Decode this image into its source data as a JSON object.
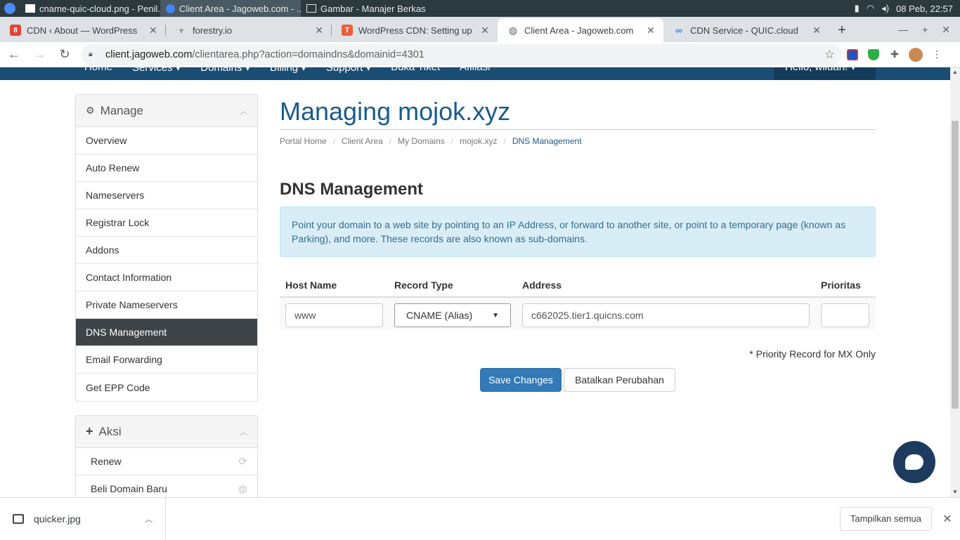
{
  "os": {
    "windows": [
      {
        "label": "cname-quic-cloud.png - Penil..."
      },
      {
        "label": "Client Area - Jagoweb.com - ..."
      },
      {
        "label": "Gambar - Manajer Berkas"
      }
    ],
    "clock": "08 Peb, 22:57"
  },
  "browser": {
    "tabs": [
      {
        "label": "CDN ‹ About — WordPress",
        "favicon_color": "#e0443a"
      },
      {
        "label": "forestry.io",
        "favicon_color": "#3c4043"
      },
      {
        "label": "WordPress CDN: Setting up qu",
        "favicon_color": "#e8613c"
      },
      {
        "label": "Client Area - Jagoweb.com",
        "favicon_color": "#5f6368"
      },
      {
        "label": "CDN Service - QUIC.cloud",
        "favicon_color": "#3a8ed8"
      }
    ],
    "active_tab": 3,
    "url_host": "client.jagoweb.com",
    "url_path": "/clientarea.php?action=domaindns&domainid=4301"
  },
  "site": {
    "nav": [
      "Home",
      "Services ▾",
      "Domains ▾",
      "Billing ▾",
      "Support ▾",
      "Buka Tiket",
      "Afiliasi"
    ],
    "hello": "Hello, wildan! ▾"
  },
  "sidebar": {
    "manage_title": "Manage",
    "manage_items": [
      {
        "label": "Overview"
      },
      {
        "label": "Auto Renew"
      },
      {
        "label": "Nameservers"
      },
      {
        "label": "Registrar Lock"
      },
      {
        "label": "Addons"
      },
      {
        "label": "Contact Information"
      },
      {
        "label": "Private Nameservers"
      },
      {
        "label": "DNS Management"
      },
      {
        "label": "Email Forwarding"
      },
      {
        "label": "Get EPP Code"
      }
    ],
    "active_index": 7,
    "aksi_title": "Aksi",
    "aksi_items": [
      {
        "label": "Renew",
        "icon": "refresh-icon"
      },
      {
        "label": "Beli Domain Baru",
        "icon": "globe-icon"
      }
    ]
  },
  "main": {
    "title": "Managing mojok.xyz",
    "breadcrumb": [
      "Portal Home",
      "Client Area",
      "My Domains",
      "mojok.xyz",
      "DNS Management"
    ],
    "section_title": "DNS Management",
    "info": "Point your domain to a web site by pointing to an IP Address, or forward to another site, or point to a temporary page (known as Parking), and more. These records are also known as sub-domains.",
    "table": {
      "headers": [
        "Host Name",
        "Record Type",
        "Address",
        "Prioritas"
      ],
      "row": {
        "host": "www",
        "type": "CNAME (Alias)",
        "address": "c662025.tier1.quicns.com",
        "priority": ""
      }
    },
    "priority_note": "* Priority Record for MX Only",
    "save_label": "Save Changes",
    "cancel_label": "Batalkan Perubahan"
  },
  "downloads": {
    "file": "quicker.jpg",
    "show_all": "Tampilkan semua"
  },
  "colors": {
    "nav_bg": "#1a4d73",
    "title_blue": "#1a5b8c",
    "primary_button": "#337ab7",
    "active_menu": "#3f4448",
    "alert_bg": "#d9edf7"
  }
}
